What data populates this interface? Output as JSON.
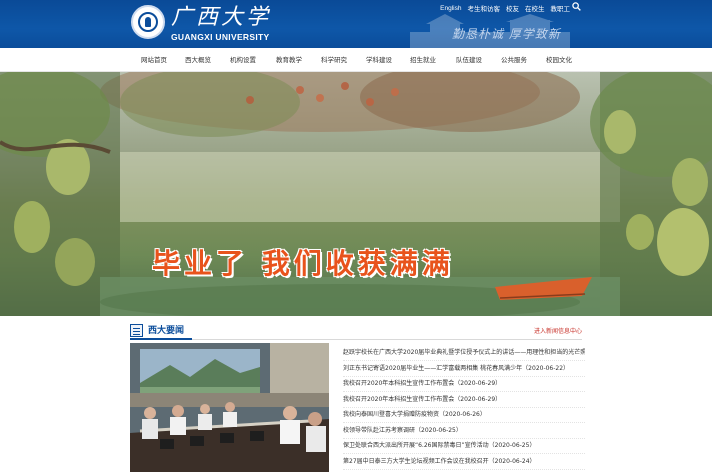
{
  "header": {
    "logo_cn": "广西大学",
    "logo_en": "GUANGXI UNIVERSITY",
    "motto": "勤恳朴诚 厚学致新",
    "top_links": [
      "English",
      "考生和访客",
      "校友",
      "在校生",
      "教职工"
    ]
  },
  "nav": {
    "items": [
      "网站首页",
      "西大概览",
      "机构设置",
      "教育教学",
      "科学研究",
      "学科建设",
      "招生就业",
      "队伍建设",
      "公共服务",
      "校园文化"
    ]
  },
  "banner": {
    "title": "毕业了  我们收获满满"
  },
  "news": {
    "title": "西大要闻",
    "more": "进入新闻信息中心",
    "items": [
      "赵跃宇校长在广西大学2020届毕业典礼暨学位授予仪式上的讲话——用理性和担当的光芒照...",
      "刘正东书记寄语2020届毕业生——汇学富载两相集 桃花春风满少年（2020-06-22）",
      "我校召开2020年本科招生宣传工作布置会（2020-06-29）",
      "我校召开2020年本科招生宣传工作布置会（2020-06-29）",
      "我校向泰国川登喜大学捐赠防疫物资（2020-06-26）",
      "校领导带队赴江苏考察调研（2020-06-25）",
      "保卫处联合西大派出所开展“6.26国际禁毒日”宣传活动（2020-06-25）",
      "第27届中日泰三方大学生论坛视频工作会议在我校召开（2020-06-24）"
    ]
  },
  "colors": {
    "header_blue": "#0b4d9b",
    "banner_text": "#e8531c",
    "more_link": "#c8322a"
  }
}
